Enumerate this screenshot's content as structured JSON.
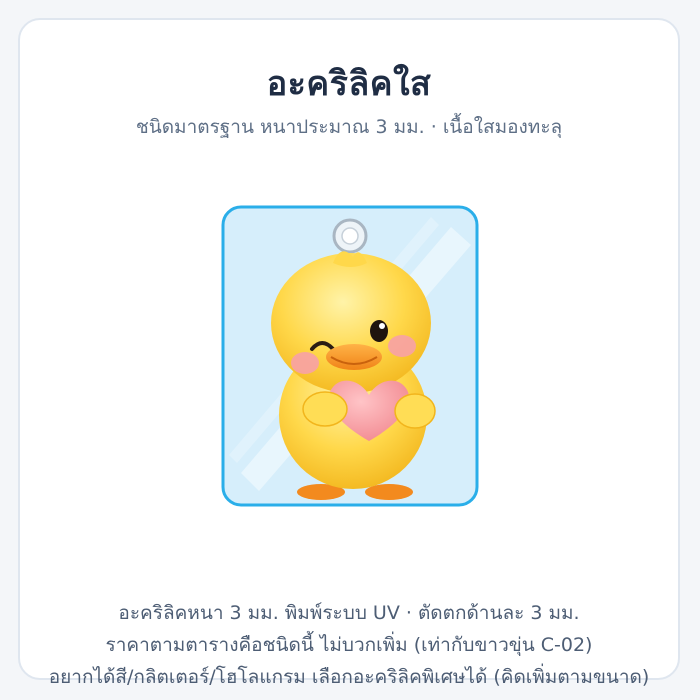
{
  "card": {
    "title": "อะคริลิคใส",
    "subtitle": "ชนิดมาตรฐาน หนาประมาณ 3 มม. · เนื้อใสมองทะลุ"
  },
  "footer": {
    "line1": "อะคริลิคหนา 3 มม. พิมพ์ระบบ UV · ตัดตกด้านละ 3 มม.",
    "line2": "ราคาตามตารางคือชนิดนี้ ไม่บวกเพิ่ม (เท่ากับขาวขุ่น C-02)",
    "line3": "อยากได้สี/กลิตเตอร์/โฮโลแกรม เลือกอะคริลิคพิเศษได้ (คิดเพิ่มตามขนาด)"
  },
  "colors": {
    "border_accent": "#2aaee9",
    "charm_fill": "#d6eefb",
    "duck_body": "#ffd84a",
    "heart": "#f7a1a6"
  },
  "illustration": {
    "subject": "yellow duckling holding a pink heart on a clear acrylic keychain charm"
  }
}
